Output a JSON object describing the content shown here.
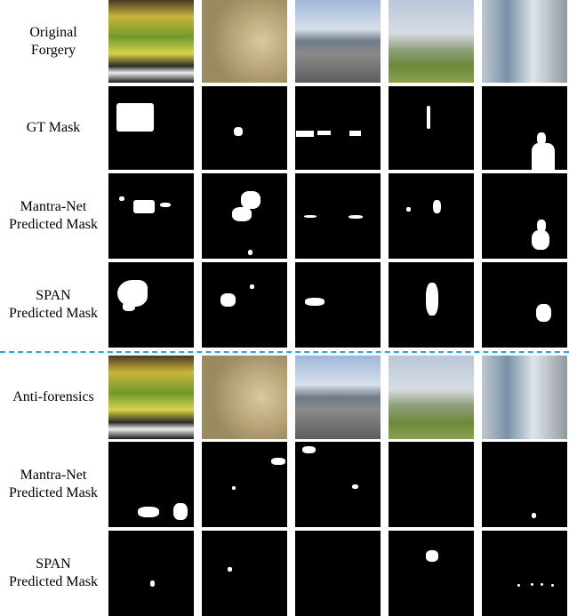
{
  "rows": {
    "original": [
      "Original",
      "Forgery"
    ],
    "gt": [
      "GT Mask"
    ],
    "mantra": [
      "Mantra-Net",
      "Predicted Mask"
    ],
    "span": [
      "SPAN",
      "Predicted Mask"
    ],
    "anti": [
      "Anti-forensics"
    ],
    "mantra2": [
      "Mantra-Net",
      "Predicted Mask"
    ],
    "span2": [
      "SPAN",
      "Predicted Mask"
    ]
  },
  "separator_color": "#29a8e0"
}
